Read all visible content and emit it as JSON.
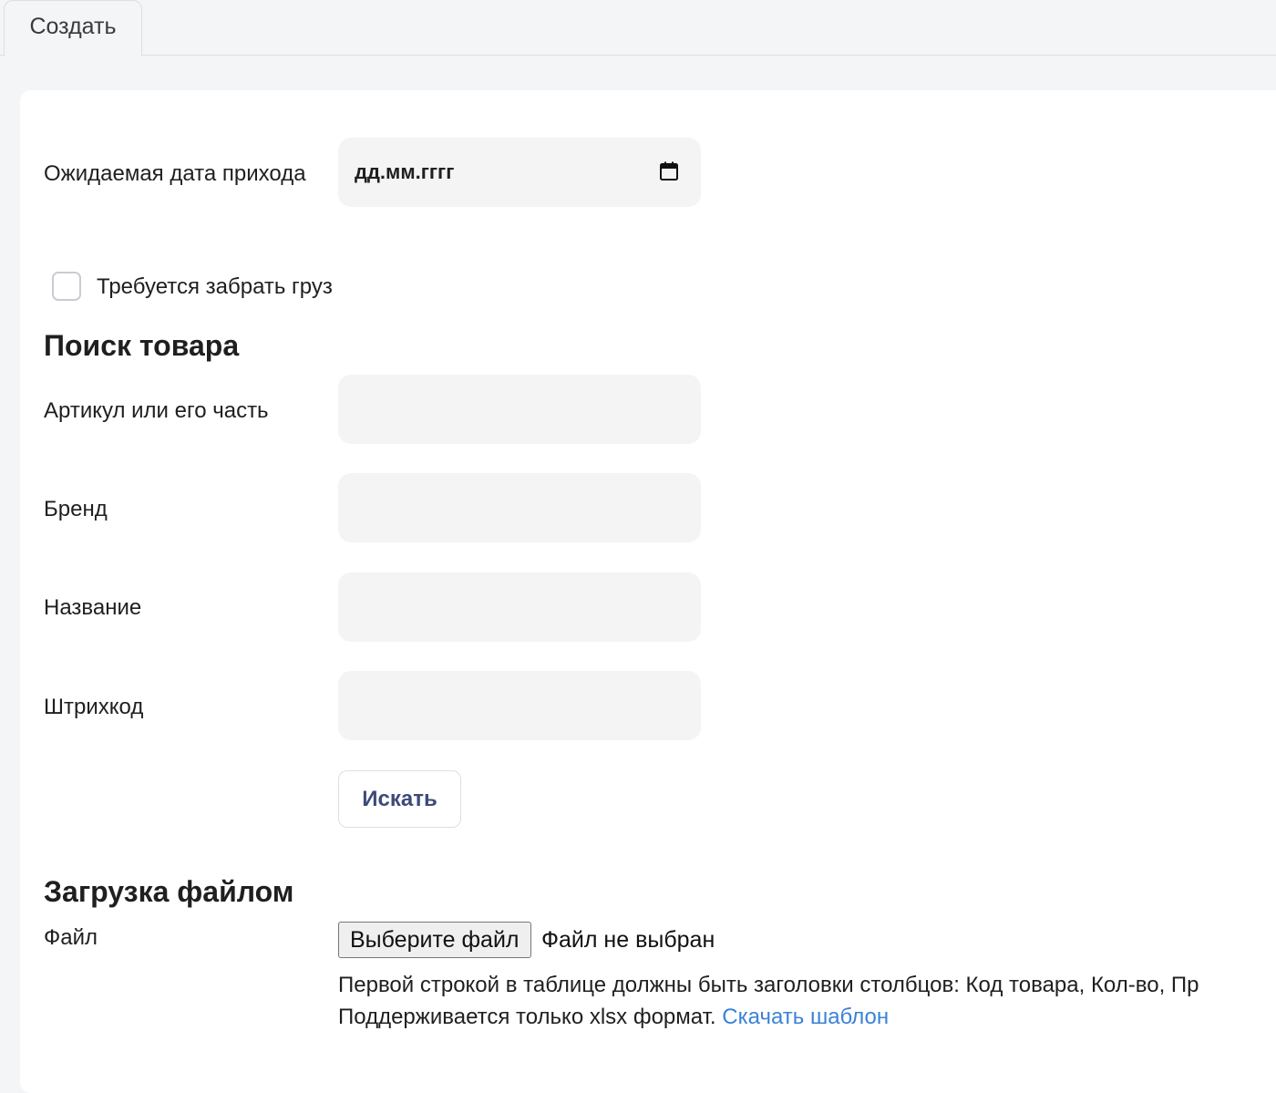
{
  "tabs": [
    {
      "label": "Создать"
    }
  ],
  "form": {
    "date": {
      "label": "Ожидаемая дата прихода",
      "placeholder": "дд.мм.гггг"
    },
    "pickup": {
      "label": "Требуется забрать груз",
      "checked": false
    }
  },
  "search": {
    "title": "Поиск товара",
    "fields": {
      "article": {
        "label": "Артикул или его часть",
        "value": ""
      },
      "brand": {
        "label": "Бренд",
        "value": ""
      },
      "name": {
        "label": "Название",
        "value": ""
      },
      "barcode": {
        "label": "Штрихкод",
        "value": ""
      }
    },
    "button_label": "Искать"
  },
  "upload": {
    "title": "Загрузка файлом",
    "file_label": "Файл",
    "choose_button": "Выберите файл",
    "no_file": "Файл не выбран",
    "hint_line1": "Первой строкой в таблице должны быть заголовки столбцов: Код товара, Кол-во, Пр",
    "hint_line2": "Поддерживается только xlsx формат.",
    "template_link": "Скачать шаблон"
  },
  "colors": {
    "accent_button_text": "#3d4a7a",
    "link": "#3b82d6",
    "input_bg": "#f4f4f4",
    "page_bg": "#f4f5f7"
  }
}
